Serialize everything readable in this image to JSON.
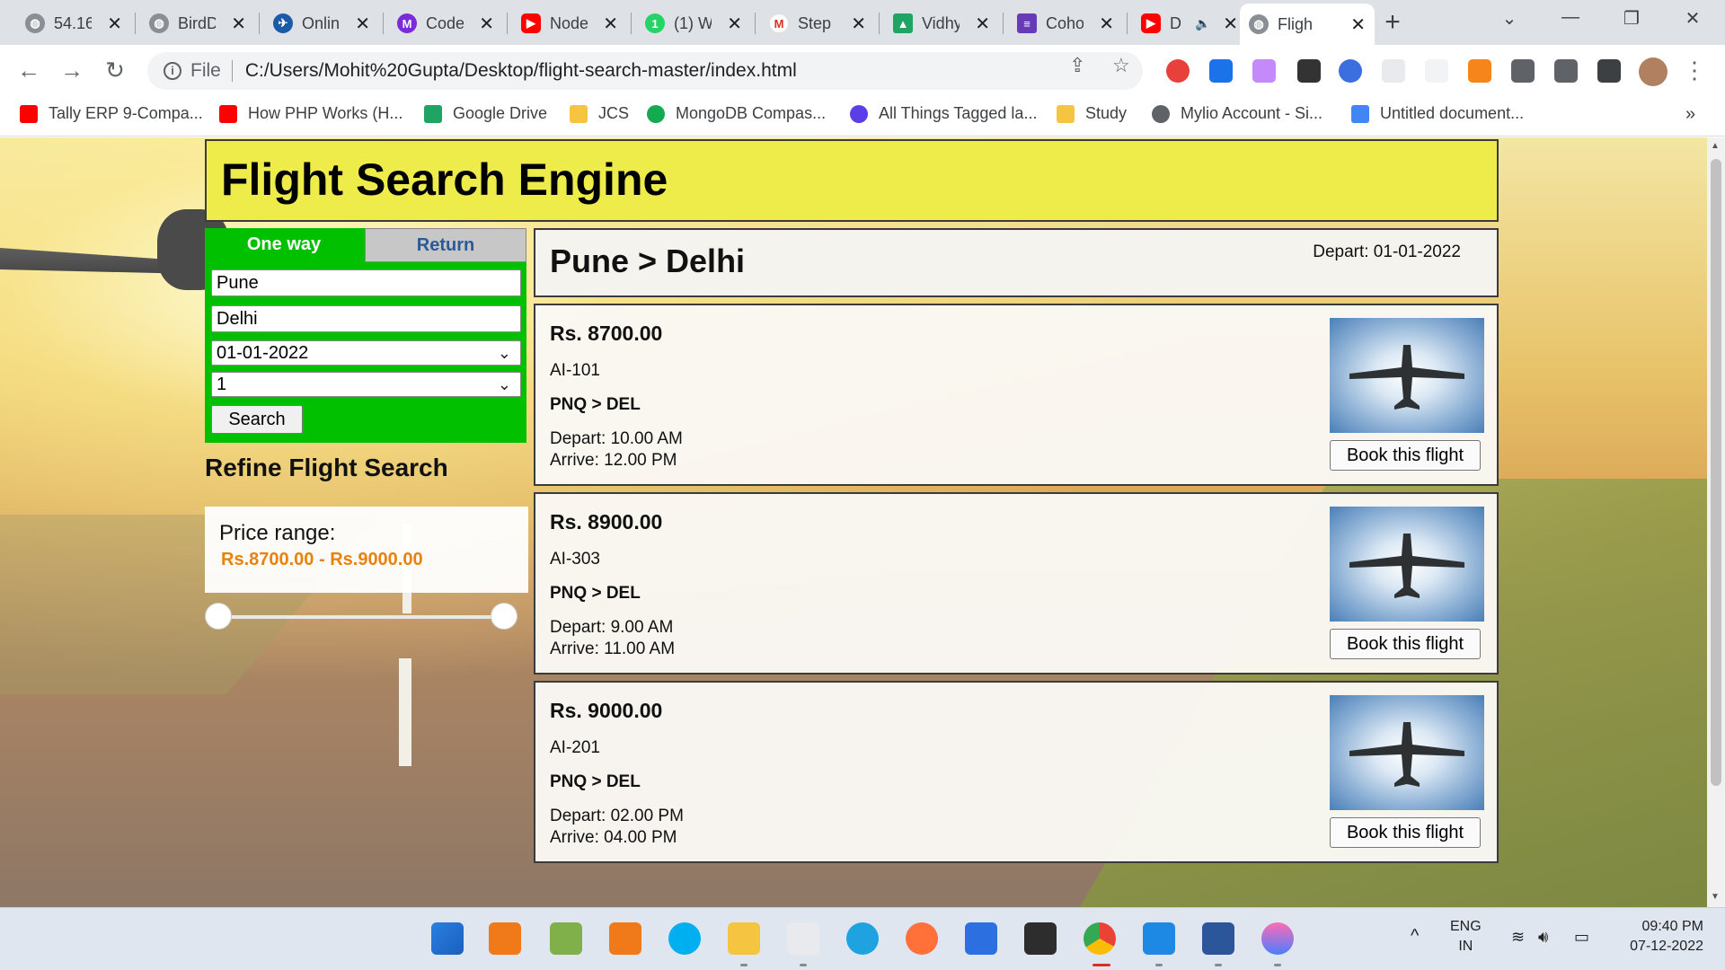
{
  "browser": {
    "tabs": [
      {
        "label": "54.16",
        "icon": "globe-icon",
        "color": "#5f6368"
      },
      {
        "label": "BirdD",
        "icon": "globe-icon",
        "color": "#5f6368"
      },
      {
        "label": "Onlin",
        "icon": "airline-icon",
        "color": "#1a5aa8"
      },
      {
        "label": "Code",
        "icon": "m-logo-icon",
        "color": "#7b2bd9"
      },
      {
        "label": "Node",
        "icon": "youtube-icon",
        "color": "#ff0000"
      },
      {
        "label": "(1) W",
        "icon": "whatsapp-icon",
        "color": "#25d366"
      },
      {
        "label": "Step",
        "icon": "gmail-icon",
        "color": "#d93025"
      },
      {
        "label": "Vidhy",
        "icon": "drive-icon",
        "color": "#1fa463"
      },
      {
        "label": "Coho",
        "icon": "forms-icon",
        "color": "#673ab7"
      },
      {
        "label": "D",
        "icon": "youtube-icon",
        "color": "#ff0000"
      },
      {
        "label": "Fligh",
        "icon": "globe-icon",
        "color": "#5f6368"
      }
    ],
    "address": {
      "scheme": "File",
      "url": "C:/Users/Mohit%20Gupta/Desktop/flight-search-master/index.html"
    },
    "bookmarks": [
      {
        "label": "Tally ERP 9-Compa...",
        "color": "#ff0000"
      },
      {
        "label": "How PHP Works (H...",
        "color": "#ff0000"
      },
      {
        "label": "Google Drive",
        "color": "#1fa463"
      },
      {
        "label": "JCS",
        "color": "#f5c542"
      },
      {
        "label": "MongoDB Compas...",
        "color": "#13aa52"
      },
      {
        "label": "All Things Tagged la...",
        "color": "#5c3ee8"
      },
      {
        "label": "Study",
        "color": "#f5c542"
      },
      {
        "label": "Mylio Account - Si...",
        "color": "#5f6368"
      },
      {
        "label": "Untitled document...",
        "color": "#4285f4"
      }
    ]
  },
  "page": {
    "title": "Flight Search Engine",
    "search": {
      "tab_oneway": "One way",
      "tab_return": "Return",
      "origin": "Pune",
      "destination": "Delhi",
      "date": "01-01-2022",
      "passengers": "1",
      "button": "Search"
    },
    "refine": {
      "title": "Refine Flight Search",
      "price_label": "Price range:",
      "price_value": "Rs.8700.00 - Rs.9000.00",
      "slider_min_fraction": 0,
      "slider_max_fraction": 1
    },
    "route": {
      "title": "Pune > Delhi",
      "depart": "Depart: 01-01-2022"
    },
    "flights": [
      {
        "price": "Rs. 8700.00",
        "number": "AI-101",
        "route": "PNQ > DEL",
        "depart": "Depart: 10.00 AM",
        "arrive": "Arrive: 12.00 PM",
        "button": "Book this flight"
      },
      {
        "price": "Rs. 8900.00",
        "number": "AI-303",
        "route": "PNQ > DEL",
        "depart": "Depart: 9.00 AM",
        "arrive": "Arrive: 11.00 AM",
        "button": "Book this flight"
      },
      {
        "price": "Rs. 9000.00",
        "number": "AI-201",
        "route": "PNQ > DEL",
        "depart": "Depart: 02.00 PM",
        "arrive": "Arrive: 04.00 PM",
        "button": "Book this flight"
      }
    ]
  },
  "taskbar": {
    "lang_top": "ENG",
    "lang_bottom": "IN",
    "time": "09:40 PM",
    "date": "07-12-2022"
  }
}
